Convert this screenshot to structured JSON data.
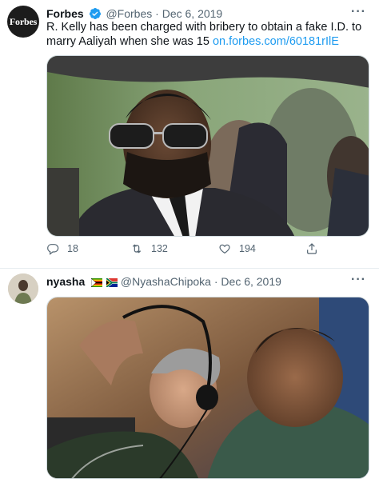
{
  "tweets": [
    {
      "avatar_text": "Forbes",
      "name": "Forbes",
      "handle": "@Forbes",
      "date": "Dec 6, 2019",
      "text": "R. Kelly has been charged with bribery to obtain a fake I.D. to marry Aaliyah when she was 15",
      "link": "on.forbes.com/60181rIlE",
      "more": "···",
      "actions": {
        "reply_count": "18",
        "retweet_count": "132",
        "like_count": "194"
      },
      "media_description": "photo"
    },
    {
      "name": "nyasha",
      "flags": [
        "zimbabwe-flag",
        "south-africa-flag"
      ],
      "handle": "@NyashaChipoka",
      "date": "Dec 6, 2019",
      "more": "···",
      "media_description": "photo"
    }
  ],
  "separator": "·",
  "colors": {
    "link": "#1d9bf0",
    "secondary_text": "#536471",
    "verified": "#1d9bf0",
    "border": "#e6ecf0"
  }
}
